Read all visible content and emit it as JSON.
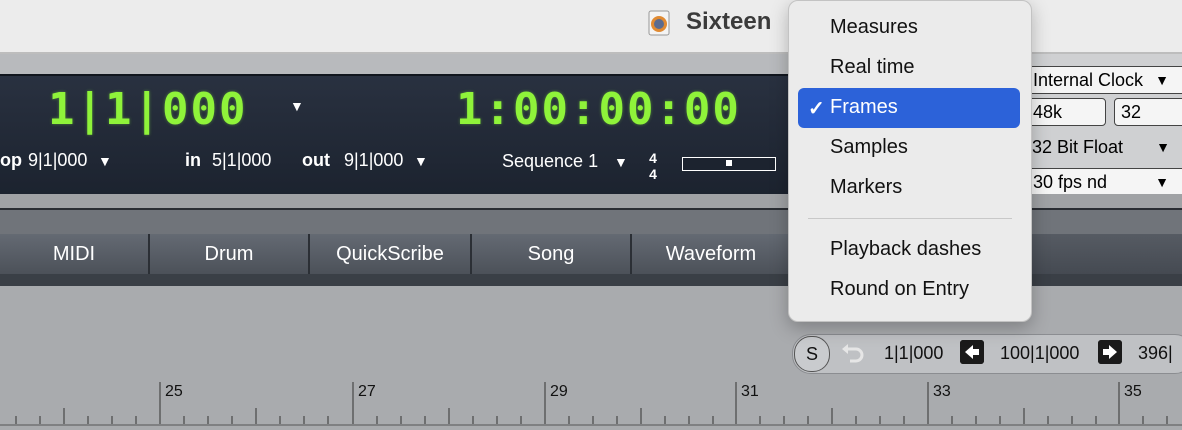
{
  "window": {
    "title": "Sixteen"
  },
  "control_panel": {
    "measure_readout": "1|1|000",
    "time_readout": "1:00:00:00",
    "loop_label": "op",
    "loop_value": "9|1|000",
    "in_label": "in",
    "in_value": "5|1|000",
    "out_label": "out",
    "out_value": "9|1|000",
    "sequence_name": "Sequence 1",
    "meter_top": "4",
    "meter_bottom": "4"
  },
  "right_panel": {
    "clock_source": "Internal Clock",
    "sample_rate": "48k",
    "buffer": "32",
    "bit_depth": "32 Bit Float",
    "frame_rate": "30 fps nd"
  },
  "tabs": [
    {
      "label": "MIDI"
    },
    {
      "label": "Drum"
    },
    {
      "label": "QuickScribe"
    },
    {
      "label": "Song"
    },
    {
      "label": "Waveform"
    }
  ],
  "transport": {
    "s_label": "S",
    "start": "1|1|000",
    "end": "100|1|000",
    "overflow": "396|"
  },
  "ruler": {
    "labels": [
      "25",
      "27",
      "29",
      "31",
      "33",
      "35"
    ]
  },
  "menu": {
    "items": [
      "Measures",
      "Real time",
      "Frames",
      "Samples",
      "Markers"
    ],
    "selected": "Frames",
    "check": "✓",
    "options": [
      "Playback dashes",
      "Round on Entry"
    ]
  },
  "colors": {
    "lcd_green": "#8ff33a",
    "menu_highlight": "#2c62d9",
    "panel_dark": "#1f2633"
  }
}
